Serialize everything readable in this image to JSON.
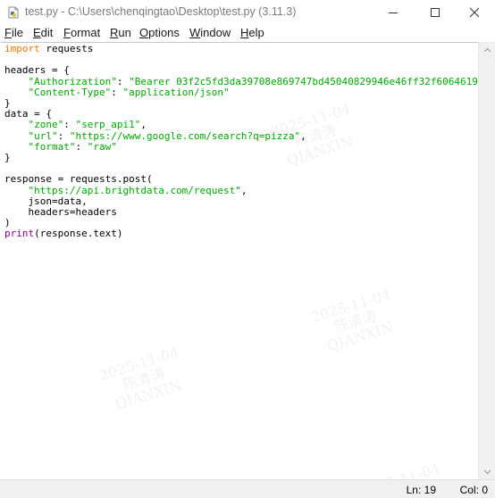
{
  "window": {
    "title": "test.py - C:\\Users\\chenqingtao\\Desktop\\test.py (3.11.3)",
    "icons": {
      "app": "python-file-icon",
      "minimize": "minimize-icon",
      "maximize": "maximize-icon",
      "close": "close-icon"
    }
  },
  "menu": {
    "file": {
      "u": "F",
      "rest": "ile"
    },
    "edit": {
      "u": "E",
      "rest": "dit"
    },
    "format": {
      "u": "F",
      "rest": "ormat"
    },
    "run": {
      "u": "R",
      "rest": "un"
    },
    "options": {
      "u": "O",
      "rest": "ptions"
    },
    "window": {
      "u": "W",
      "rest": "indow"
    },
    "help": {
      "u": "H",
      "rest": "elp"
    }
  },
  "code": {
    "l1": {
      "kw": "import",
      "rest": " requests"
    },
    "l3": "headers = {",
    "l4": {
      "indent": "    ",
      "key": "\"Authorization\"",
      "sep": ": ",
      "val": "\"Bearer 03f2c5fd3da39708e869747bd45040829946e46ff32f6064619"
    },
    "l5": {
      "indent": "    ",
      "key": "\"Content-Type\"",
      "sep": ": ",
      "val": "\"application/json\""
    },
    "l6": "}",
    "l7": "data = {",
    "l8": {
      "indent": "    ",
      "key": "\"zone\"",
      "sep": ": ",
      "val": "\"serp_api1\"",
      "end": ","
    },
    "l9": {
      "indent": "    ",
      "key": "\"url\"",
      "sep": ": ",
      "val": "\"https://www.google.com/search?q=pizza\"",
      "end": ","
    },
    "l10": {
      "indent": "    ",
      "key": "\"format\"",
      "sep": ": ",
      "val": "\"raw\""
    },
    "l11": "}",
    "l13": "response = requests.post(",
    "l14": {
      "indent": "    ",
      "val": "\"https://api.brightdata.com/request\"",
      "end": ","
    },
    "l15": "    json=data,",
    "l16": "    headers=headers",
    "l17": ")",
    "l18": {
      "bi": "print",
      "rest": "(response.text)"
    }
  },
  "status": {
    "line": "Ln: 19",
    "col": "Col: 0"
  },
  "watermark": {
    "date": "2025-11-04",
    "name": "陈清涛",
    "org": "QIANXIN"
  }
}
